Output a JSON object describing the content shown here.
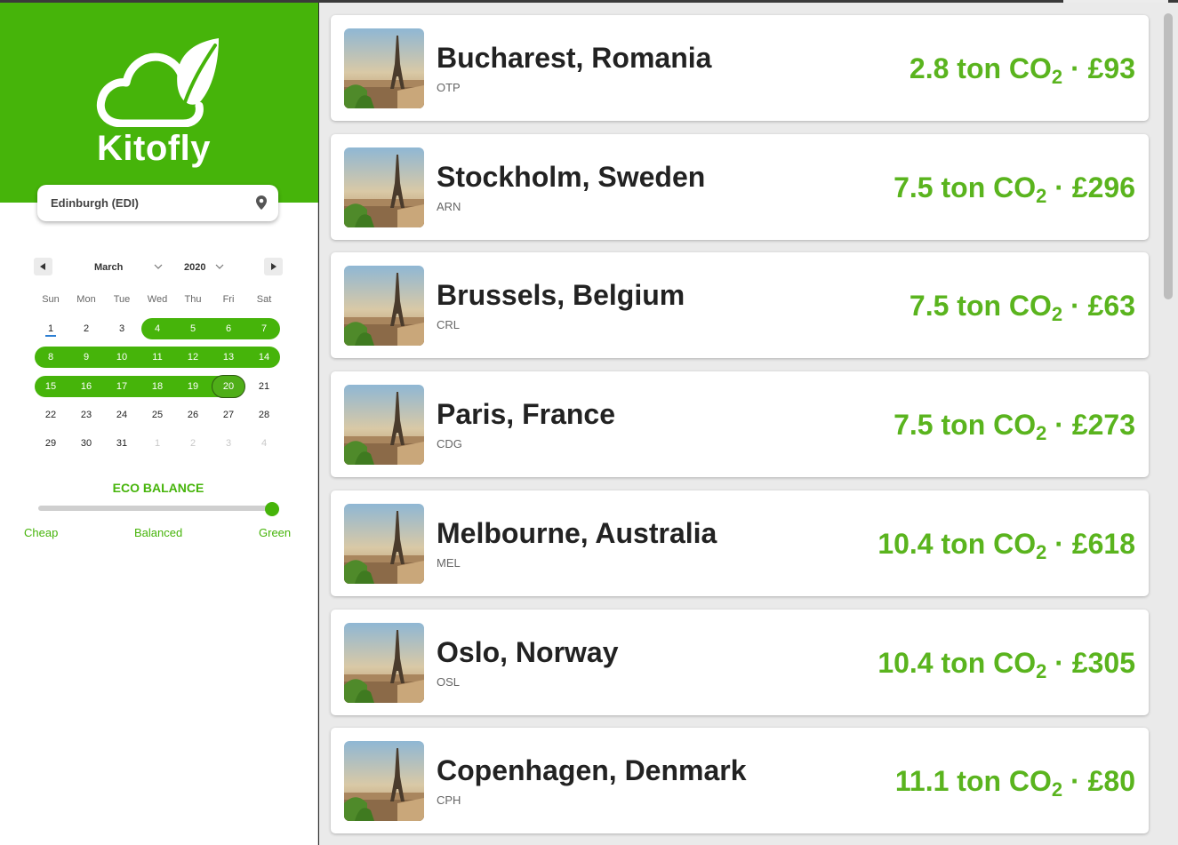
{
  "app": {
    "name": "Kitofly",
    "accent_color": "#46b40a",
    "price_color": "#5ab41e"
  },
  "search": {
    "origin_value": "Edinburgh (EDI)",
    "origin_icon": "location-pin-icon"
  },
  "calendar": {
    "month": "March",
    "year": "2020",
    "weekdays": [
      "Sun",
      "Mon",
      "Tue",
      "Wed",
      "Thu",
      "Fri",
      "Sat"
    ],
    "weeks": [
      [
        "1",
        "2",
        "3",
        "4",
        "5",
        "6",
        "7"
      ],
      [
        "8",
        "9",
        "10",
        "11",
        "12",
        "13",
        "14"
      ],
      [
        "15",
        "16",
        "17",
        "18",
        "19",
        "20",
        "21"
      ],
      [
        "22",
        "23",
        "24",
        "25",
        "26",
        "27",
        "28"
      ],
      [
        "29",
        "30",
        "31",
        "1",
        "2",
        "3",
        "4"
      ]
    ],
    "today": "1",
    "range_start": "4",
    "range_end": "20"
  },
  "eco_balance": {
    "title": "ECO BALANCE",
    "labels": [
      "Cheap",
      "Balanced",
      "Green"
    ],
    "value": 1.0
  },
  "results": [
    {
      "city": "Bucharest, Romania",
      "code": "OTP",
      "co2_value": "2.8",
      "co2_unit": "ton CO",
      "co2_sub": "2",
      "price": "£93"
    },
    {
      "city": "Stockholm, Sweden",
      "code": "ARN",
      "co2_value": "7.5",
      "co2_unit": "ton CO",
      "co2_sub": "2",
      "price": "£296"
    },
    {
      "city": "Brussels, Belgium",
      "code": "CRL",
      "co2_value": "7.5",
      "co2_unit": "ton CO",
      "co2_sub": "2",
      "price": "£63"
    },
    {
      "city": "Paris, France",
      "code": "CDG",
      "co2_value": "7.5",
      "co2_unit": "ton CO",
      "co2_sub": "2",
      "price": "£273"
    },
    {
      "city": "Melbourne, Australia",
      "code": "MEL",
      "co2_value": "10.4",
      "co2_unit": "ton CO",
      "co2_sub": "2",
      "price": "£618"
    },
    {
      "city": "Oslo, Norway",
      "code": "OSL",
      "co2_value": "10.4",
      "co2_unit": "ton CO",
      "co2_sub": "2",
      "price": "£305"
    },
    {
      "city": "Copenhagen, Denmark",
      "code": "CPH",
      "co2_value": "11.1",
      "co2_unit": "ton CO",
      "co2_sub": "2",
      "price": "£80"
    }
  ]
}
